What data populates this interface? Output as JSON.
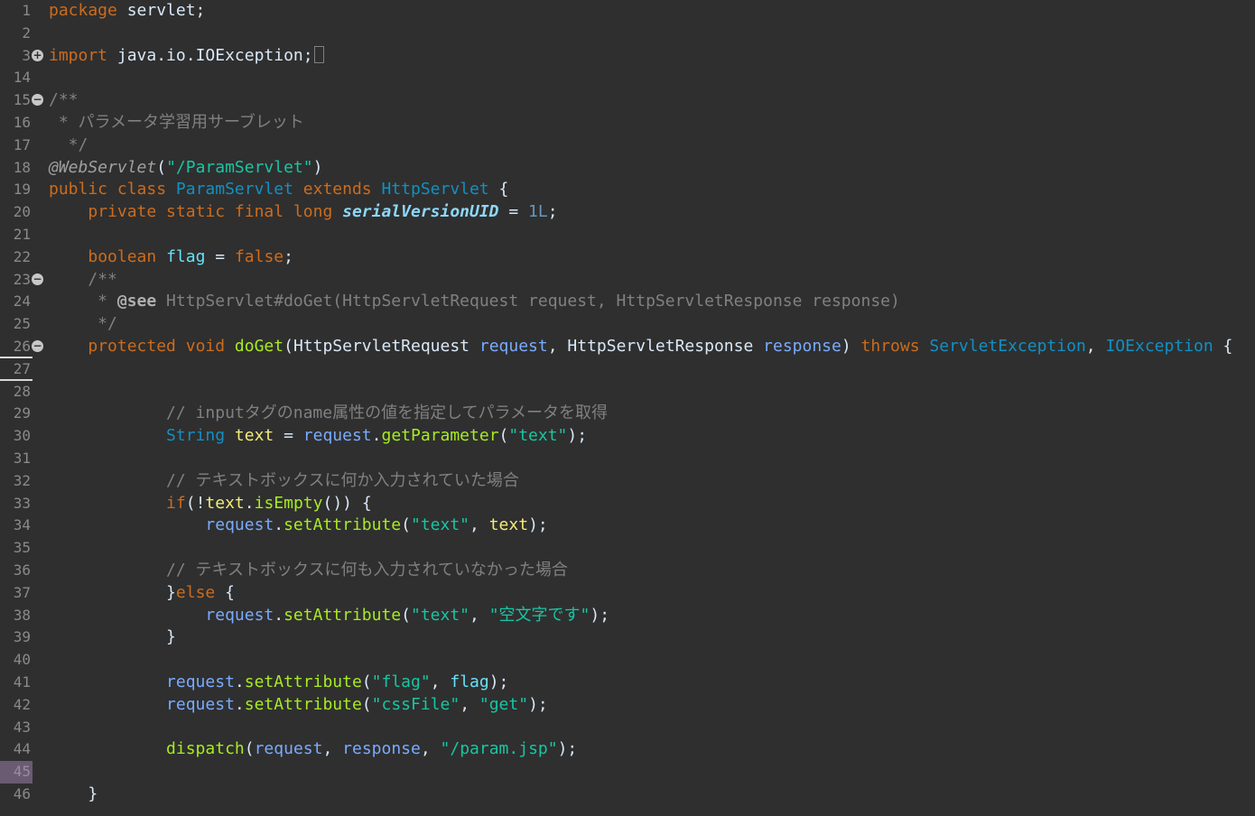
{
  "editor": {
    "lines": [
      {
        "num": "1",
        "tokens": [
          [
            "kw",
            "package"
          ],
          [
            "plain",
            " servlet;"
          ]
        ]
      },
      {
        "num": "2",
        "tokens": []
      },
      {
        "num": "3",
        "fold": "+",
        "tokens": [
          [
            "kw",
            "import"
          ],
          [
            "plain",
            " java.io.IOException;"
          ],
          [
            "box",
            ""
          ]
        ]
      },
      {
        "num": "14",
        "tokens": []
      },
      {
        "num": "15",
        "fold": "-",
        "tokens": [
          [
            "doc",
            "/**"
          ]
        ]
      },
      {
        "num": "16",
        "tokens": [
          [
            "doc",
            " * パラメータ学習用サーブレット"
          ]
        ]
      },
      {
        "num": "17",
        "tokens": [
          [
            "doc",
            "  */"
          ]
        ]
      },
      {
        "num": "18",
        "tokens": [
          [
            "anno",
            "@WebServlet"
          ],
          [
            "plain",
            "("
          ],
          [
            "str",
            "\"/ParamServlet\""
          ],
          [
            "plain",
            ")"
          ]
        ]
      },
      {
        "num": "19",
        "tokens": [
          [
            "kw",
            "public class "
          ],
          [
            "cls",
            "ParamServlet"
          ],
          [
            "kw",
            " extends "
          ],
          [
            "cls",
            "HttpServlet"
          ],
          [
            "plain",
            " {"
          ]
        ]
      },
      {
        "num": "20",
        "tokens": [
          [
            "plain",
            "    "
          ],
          [
            "kw",
            "private static final long "
          ],
          [
            "static",
            "serialVersionUID"
          ],
          [
            "plain",
            " = "
          ],
          [
            "num",
            "1L"
          ],
          [
            "plain",
            ";"
          ]
        ]
      },
      {
        "num": "21",
        "tokens": []
      },
      {
        "num": "22",
        "tokens": [
          [
            "plain",
            "    "
          ],
          [
            "kw",
            "boolean "
          ],
          [
            "field",
            "flag"
          ],
          [
            "plain",
            " = "
          ],
          [
            "kw",
            "false"
          ],
          [
            "plain",
            ";"
          ]
        ]
      },
      {
        "num": "23",
        "fold": "-",
        "tokens": [
          [
            "doc",
            "    /**"
          ]
        ]
      },
      {
        "num": "24",
        "tokens": [
          [
            "doc",
            "     * "
          ],
          [
            "doctag",
            "@see"
          ],
          [
            "doc",
            " HttpServlet#doGet(HttpServletRequest request, HttpServletResponse response)"
          ]
        ]
      },
      {
        "num": "25",
        "tokens": [
          [
            "doc",
            "     */"
          ]
        ]
      },
      {
        "num": "26",
        "fold": "-",
        "marked": true,
        "tokens": [
          [
            "plain",
            "    "
          ],
          [
            "kw",
            "protected void "
          ],
          [
            "method",
            "doGet"
          ],
          [
            "plain",
            "(HttpServletRequest "
          ],
          [
            "param",
            "request"
          ],
          [
            "plain",
            ", HttpServletResponse "
          ],
          [
            "param",
            "response"
          ],
          [
            "plain",
            ") "
          ],
          [
            "kw",
            "throws "
          ],
          [
            "cls",
            "ServletException"
          ],
          [
            "plain",
            ", "
          ],
          [
            "cls",
            "IOException"
          ],
          [
            "plain",
            " {"
          ]
        ]
      },
      {
        "num": "27",
        "marked": true,
        "tokens": []
      },
      {
        "num": "28",
        "tokens": []
      },
      {
        "num": "29",
        "tokens": [
          [
            "plain",
            "            "
          ],
          [
            "comment",
            "// inputタグのname属性の値を指定してパラメータを取得"
          ]
        ]
      },
      {
        "num": "30",
        "tokens": [
          [
            "plain",
            "            "
          ],
          [
            "type",
            "String "
          ],
          [
            "local",
            "text"
          ],
          [
            "plain",
            " = "
          ],
          [
            "param",
            "request"
          ],
          [
            "plain",
            "."
          ],
          [
            "method",
            "getParameter"
          ],
          [
            "plain",
            "("
          ],
          [
            "str",
            "\"text\""
          ],
          [
            "plain",
            ");"
          ]
        ]
      },
      {
        "num": "31",
        "tokens": []
      },
      {
        "num": "32",
        "tokens": [
          [
            "plain",
            "            "
          ],
          [
            "comment",
            "// テキストボックスに何か入力されていた場合"
          ]
        ]
      },
      {
        "num": "33",
        "tokens": [
          [
            "plain",
            "            "
          ],
          [
            "kw",
            "if"
          ],
          [
            "plain",
            "(!"
          ],
          [
            "local",
            "text"
          ],
          [
            "plain",
            "."
          ],
          [
            "method",
            "isEmpty"
          ],
          [
            "plain",
            "()) {"
          ]
        ]
      },
      {
        "num": "34",
        "tokens": [
          [
            "plain",
            "                "
          ],
          [
            "param",
            "request"
          ],
          [
            "plain",
            "."
          ],
          [
            "method",
            "setAttribute"
          ],
          [
            "plain",
            "("
          ],
          [
            "str",
            "\"text\""
          ],
          [
            "plain",
            ", "
          ],
          [
            "local",
            "text"
          ],
          [
            "plain",
            ");"
          ]
        ]
      },
      {
        "num": "35",
        "tokens": []
      },
      {
        "num": "36",
        "tokens": [
          [
            "plain",
            "            "
          ],
          [
            "comment",
            "// テキストボックスに何も入力されていなかった場合"
          ]
        ]
      },
      {
        "num": "37",
        "tokens": [
          [
            "plain",
            "            }"
          ],
          [
            "kw",
            "else"
          ],
          [
            "plain",
            " {"
          ]
        ]
      },
      {
        "num": "38",
        "tokens": [
          [
            "plain",
            "                "
          ],
          [
            "param",
            "request"
          ],
          [
            "plain",
            "."
          ],
          [
            "method",
            "setAttribute"
          ],
          [
            "plain",
            "("
          ],
          [
            "str",
            "\"text\""
          ],
          [
            "plain",
            ", "
          ],
          [
            "str",
            "\"空文字です\""
          ],
          [
            "plain",
            ");"
          ]
        ]
      },
      {
        "num": "39",
        "tokens": [
          [
            "plain",
            "            }"
          ]
        ]
      },
      {
        "num": "40",
        "tokens": []
      },
      {
        "num": "41",
        "tokens": [
          [
            "plain",
            "            "
          ],
          [
            "param",
            "request"
          ],
          [
            "plain",
            "."
          ],
          [
            "method",
            "setAttribute"
          ],
          [
            "plain",
            "("
          ],
          [
            "str",
            "\"flag\""
          ],
          [
            "plain",
            ", "
          ],
          [
            "field",
            "flag"
          ],
          [
            "plain",
            ");"
          ]
        ]
      },
      {
        "num": "42",
        "tokens": [
          [
            "plain",
            "            "
          ],
          [
            "param",
            "request"
          ],
          [
            "plain",
            "."
          ],
          [
            "method",
            "setAttribute"
          ],
          [
            "plain",
            "("
          ],
          [
            "str",
            "\"cssFile\""
          ],
          [
            "plain",
            ", "
          ],
          [
            "str",
            "\"get\""
          ],
          [
            "plain",
            ");"
          ]
        ]
      },
      {
        "num": "43",
        "tokens": []
      },
      {
        "num": "44",
        "tokens": [
          [
            "plain",
            "            "
          ],
          [
            "method",
            "dispatch"
          ],
          [
            "plain",
            "("
          ],
          [
            "param",
            "request"
          ],
          [
            "plain",
            ", "
          ],
          [
            "param",
            "response"
          ],
          [
            "plain",
            ", "
          ],
          [
            "str",
            "\"/param.jsp\""
          ],
          [
            "plain",
            ");"
          ]
        ]
      },
      {
        "num": "45",
        "current": true,
        "tokens": []
      },
      {
        "num": "46",
        "tokens": [
          [
            "plain",
            "    }"
          ]
        ]
      }
    ]
  }
}
